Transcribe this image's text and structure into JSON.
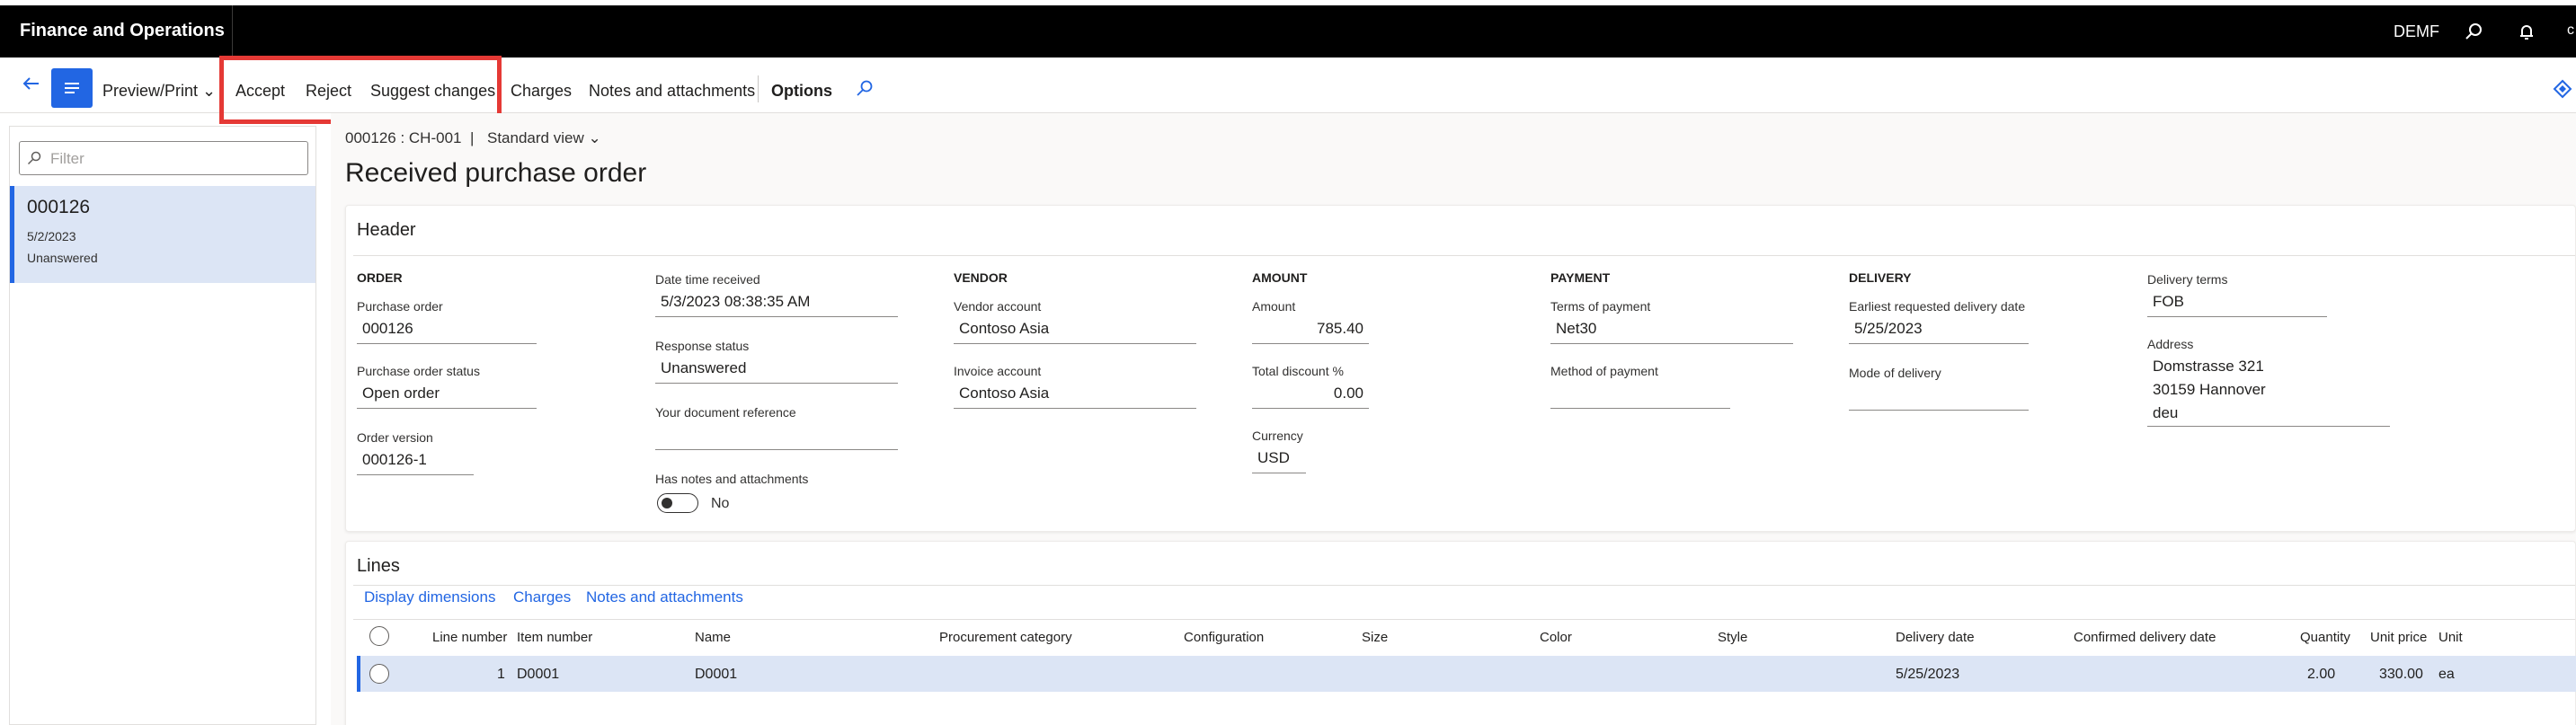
{
  "app": {
    "title": "Finance and Operations",
    "company": "DEMF"
  },
  "actions": {
    "preview_print": "Preview/Print",
    "accept": "Accept",
    "reject": "Reject",
    "suggest_changes": "Suggest changes",
    "charges": "Charges",
    "notes": "Notes and attachments",
    "options": "Options"
  },
  "filter": {
    "placeholder": "Filter"
  },
  "list": {
    "items": [
      {
        "id": "000126",
        "date": "5/2/2023",
        "status": "Unanswered"
      }
    ]
  },
  "breadcrumb": {
    "record": "000126 : CH-001",
    "separator": "|",
    "view": "Standard view"
  },
  "page": {
    "title": "Received purchase order"
  },
  "header": {
    "title": "Header",
    "order": {
      "group": "ORDER",
      "po_label": "Purchase order",
      "po_value": "000126",
      "status_label": "Purchase order status",
      "status_value": "Open order",
      "version_label": "Order version",
      "version_value": "000126-1"
    },
    "received": {
      "dt_label": "Date time received",
      "dt_value": "5/3/2023 08:38:35 AM",
      "resp_label": "Response status",
      "resp_value": "Unanswered",
      "docref_label": "Your document reference",
      "docref_value": "",
      "notes_label": "Has notes and attachments",
      "notes_value": "No"
    },
    "vendor": {
      "group": "VENDOR",
      "account_label": "Vendor account",
      "account_value": "Contoso Asia",
      "invoice_label": "Invoice account",
      "invoice_value": "Contoso Asia"
    },
    "amount": {
      "group": "AMOUNT",
      "amount_label": "Amount",
      "amount_value": "785.40",
      "discount_label": "Total discount %",
      "discount_value": "0.00",
      "currency_label": "Currency",
      "currency_value": "USD"
    },
    "payment": {
      "group": "PAYMENT",
      "terms_label": "Terms of payment",
      "terms_value": "Net30",
      "method_label": "Method of payment",
      "method_value": ""
    },
    "delivery": {
      "group": "DELIVERY",
      "earliest_label": "Earliest requested delivery date",
      "earliest_value": "5/25/2023",
      "mode_label": "Mode of delivery",
      "mode_value": ""
    },
    "terms": {
      "terms_label": "Delivery terms",
      "terms_value": "FOB",
      "address_label": "Address",
      "address_line1": "Domstrasse 321",
      "address_line2": "30159 Hannover",
      "address_line3": "deu"
    }
  },
  "lines": {
    "title": "Lines",
    "actions": [
      "Display dimensions",
      "Charges",
      "Notes and attachments"
    ],
    "columns": [
      "Line number",
      "Item number",
      "Name",
      "Procurement category",
      "Configuration",
      "Size",
      "Color",
      "Style",
      "Delivery date",
      "Confirmed delivery date",
      "Quantity",
      "Unit price",
      "Unit"
    ],
    "rows": [
      {
        "line_number": "1",
        "item_number": "D0001",
        "name": "D0001",
        "procurement_category": "",
        "configuration": "",
        "size": "",
        "color": "",
        "style": "",
        "delivery_date": "5/25/2023",
        "confirmed_delivery_date": "",
        "quantity": "2.00",
        "unit_price": "330.00",
        "unit": "ea"
      }
    ]
  },
  "colors": {
    "accent": "#2266e3",
    "highlight": "#e53935",
    "topbar": "#000000",
    "selected_row": "#dce5f5"
  }
}
